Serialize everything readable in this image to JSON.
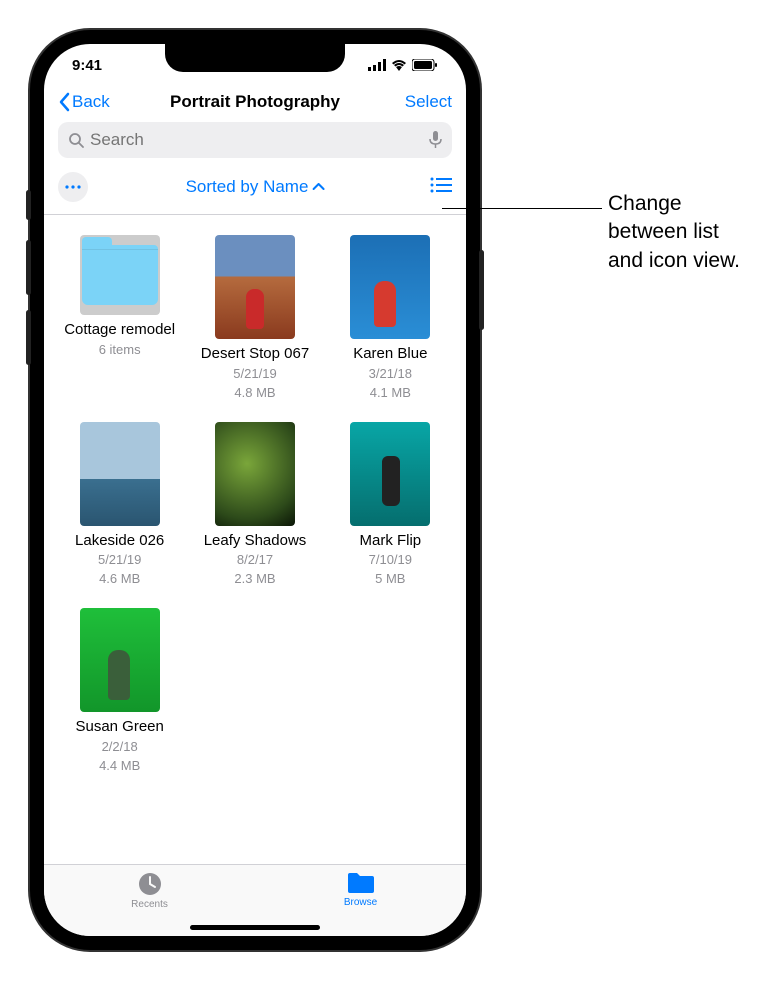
{
  "status": {
    "time": "9:41"
  },
  "nav": {
    "back_label": "Back",
    "title": "Portrait Photography",
    "select_label": "Select"
  },
  "search": {
    "placeholder": "Search"
  },
  "toolbar": {
    "sort_label": "Sorted by Name"
  },
  "items": [
    {
      "name": "Cottage remodel",
      "meta1": "6 items",
      "meta2": "",
      "type": "folder"
    },
    {
      "name": "Desert Stop 067",
      "meta1": "5/21/19",
      "meta2": "4.8 MB",
      "type": "image"
    },
    {
      "name": "Karen Blue",
      "meta1": "3/21/18",
      "meta2": "4.1 MB",
      "type": "image"
    },
    {
      "name": "Lakeside 026",
      "meta1": "5/21/19",
      "meta2": "4.6 MB",
      "type": "image"
    },
    {
      "name": "Leafy Shadows",
      "meta1": "8/2/17",
      "meta2": "2.3 MB",
      "type": "image"
    },
    {
      "name": "Mark Flip",
      "meta1": "7/10/19",
      "meta2": "5 MB",
      "type": "image"
    },
    {
      "name": "Susan Green",
      "meta1": "2/2/18",
      "meta2": "4.4 MB",
      "type": "image"
    }
  ],
  "tabs": {
    "recents": "Recents",
    "browse": "Browse"
  },
  "callout": "Change between list and icon view."
}
